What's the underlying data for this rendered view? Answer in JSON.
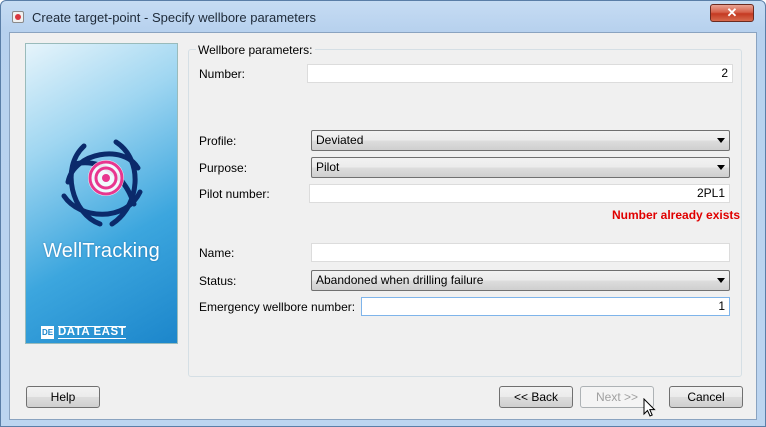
{
  "window": {
    "title": "Create target-point - Specify wellbore parameters",
    "close_label": "✕"
  },
  "side_panel": {
    "product_name": "WellTracking",
    "company_mark": "DE",
    "company_name": "DATA EAST"
  },
  "group": {
    "title": "Wellbore parameters:"
  },
  "form": {
    "number_label": "Number:",
    "number_value": "2",
    "profile_label": "Profile:",
    "profile_value": "Deviated",
    "purpose_label": "Purpose:",
    "purpose_value": "Pilot",
    "pilot_number_label": "Pilot number:",
    "pilot_number_value": "2PL1",
    "error_message": "Number already exists",
    "name_label": "Name:",
    "name_value": "",
    "status_label": "Status:",
    "status_value": "Abandoned when drilling failure",
    "emergency_label": "Emergency wellbore number:",
    "emergency_value": "1"
  },
  "buttons": {
    "help": "Help",
    "back": "<< Back",
    "next": "Next >>",
    "cancel": "Cancel"
  },
  "colors": {
    "error": "#e00000",
    "panel_blue": "#1c86cb",
    "target_pink": "#e8368f"
  }
}
